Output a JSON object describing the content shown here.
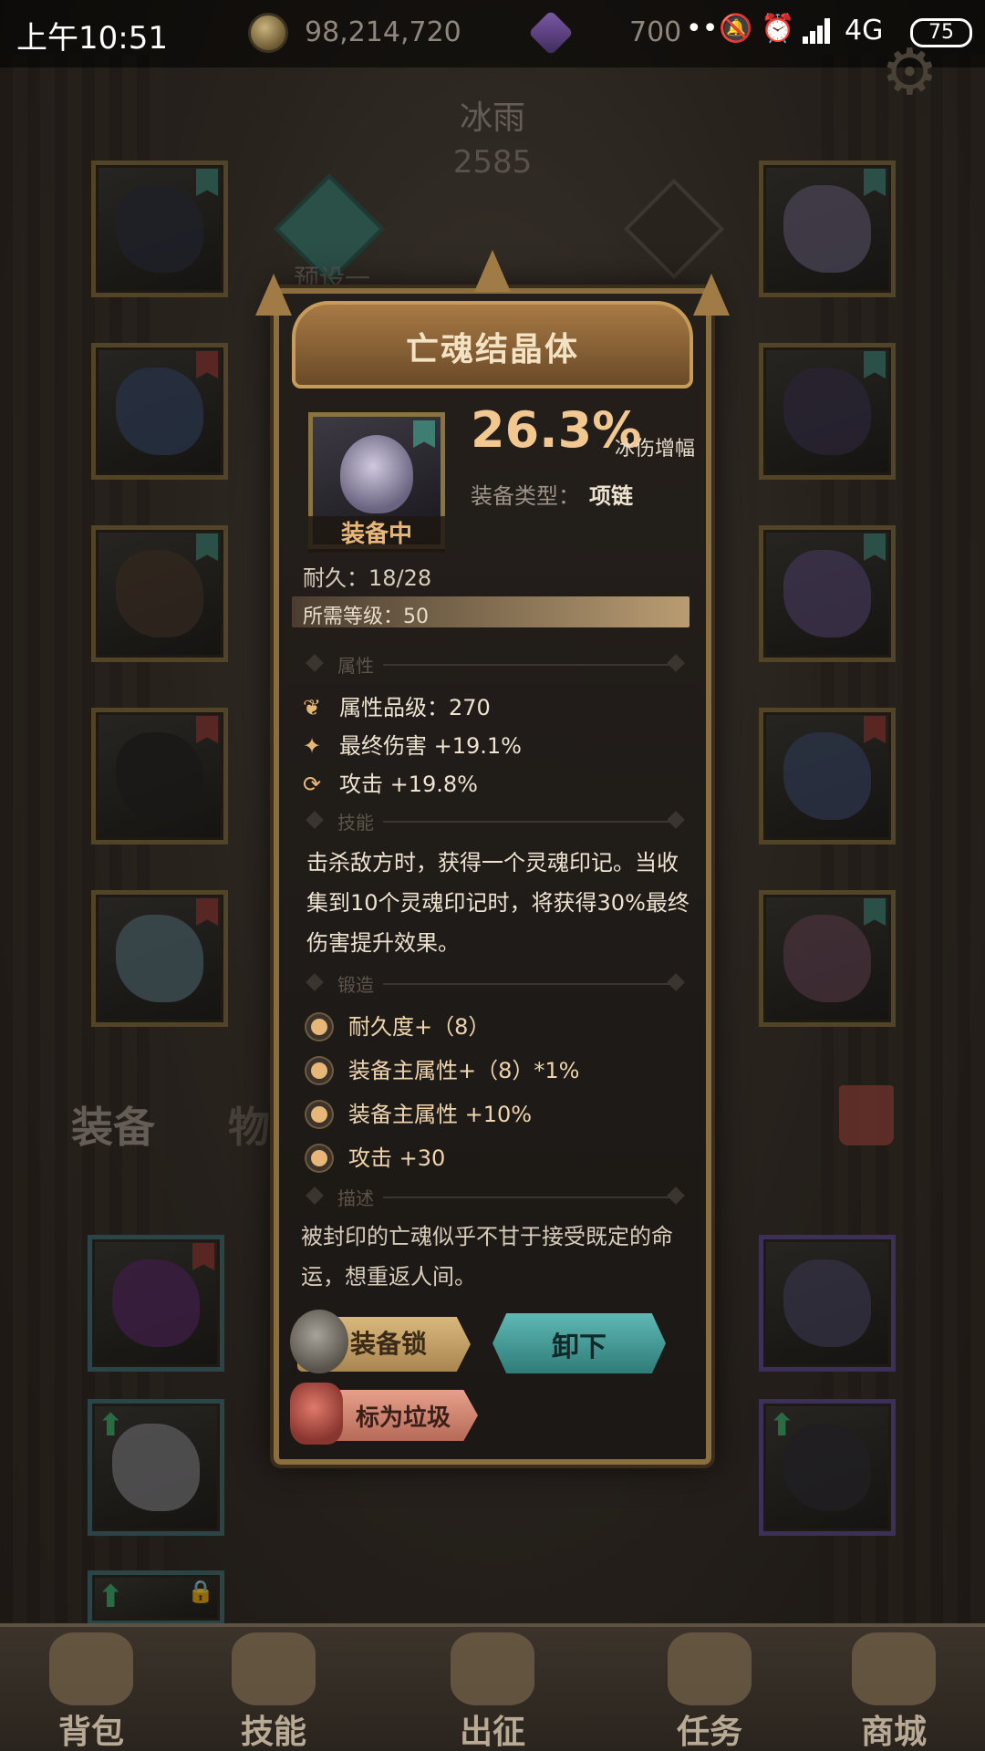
{
  "status_bar": {
    "time": "上午10:51",
    "coins": "98,214,720",
    "gems": "700",
    "more": "•••",
    "mute_icon": "🔕",
    "alarm_icon": "⏰",
    "network": "4G",
    "battery": "75"
  },
  "character": {
    "name": "冰雨",
    "power": "2585",
    "preset_label": "预设一"
  },
  "popup": {
    "title": "亡魂结晶体",
    "equipped_badge": "装备中",
    "main_stat_value": "26.3%",
    "main_stat_name": "冰伤增幅",
    "type_label": "装备类型：",
    "type_value": "项链",
    "durability": "耐久：18/28",
    "required_level": "所需等级：50",
    "sections": {
      "attributes": "属性",
      "skill": "技能",
      "forge": "锻造",
      "description": "描述"
    },
    "attributes": [
      {
        "icon": "❦",
        "text": "属性品级：270"
      },
      {
        "icon": "✦",
        "text": "最终伤害 +19.1%"
      },
      {
        "icon": "⟳",
        "text": "攻击 +19.8%"
      }
    ],
    "skill_text": "击杀敌方时，获得一个灵魂印记。当收集到10个灵魂印记时，将获得30%最终伤害提升效果。",
    "forge": [
      "耐久度+（8）",
      "装备主属性+（8）*1%",
      "装备主属性 +10%",
      "攻击 +30"
    ],
    "description": "被封印的亡魂似乎不甘于接受既定的命运，想重返人间。",
    "buttons": {
      "lock": "装备锁",
      "unequip": "卸下",
      "mark_trash": "标为垃圾"
    }
  },
  "bag_tabs": {
    "equipment": "装备",
    "items": "物品"
  },
  "bottom_nav": [
    {
      "label": "背包",
      "icon": "bag-icon"
    },
    {
      "label": "技能",
      "icon": "skill-book-icon"
    },
    {
      "label": "出征",
      "icon": "expedition-icon"
    },
    {
      "label": "任务",
      "icon": "quest-icon"
    },
    {
      "label": "商城",
      "icon": "shop-icon"
    }
  ],
  "colors": {
    "accent_gold": "#e6b779",
    "teal_button": "#2f7c78",
    "popup_bg": "#1b1815"
  }
}
